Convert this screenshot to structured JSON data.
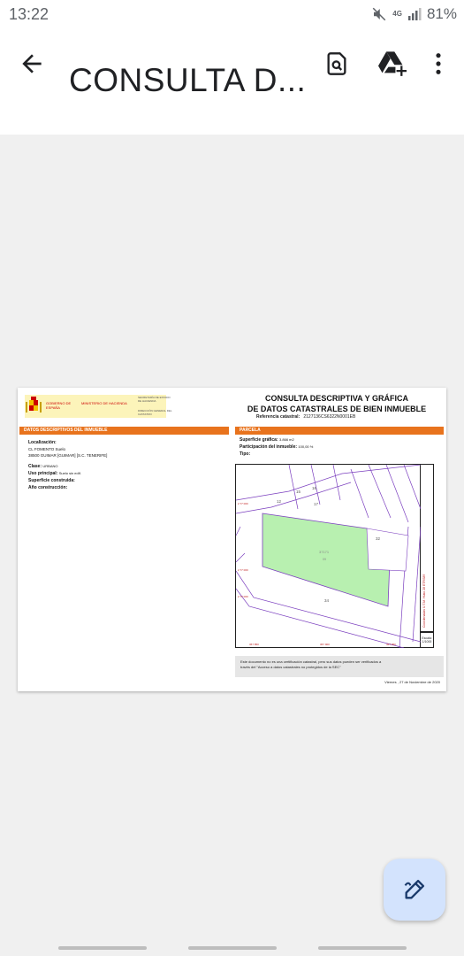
{
  "status_bar": {
    "time": "13:22",
    "network": "4G",
    "battery": "81%",
    "icons": [
      "mute-icon",
      "signal-icon",
      "battery-icon"
    ]
  },
  "app_bar": {
    "title": "CONSULTA D...",
    "icons": [
      "back-arrow-icon",
      "search-document-icon",
      "add-to-drive-icon",
      "more-vert-icon"
    ]
  },
  "document": {
    "ministry": "GOBIERNO DE ESPAÑA",
    "ministry2": "MINISTERIO DE HACIENDA",
    "secretaria": "SECRETARÍA DE ESTADO DE HACIENDA",
    "direccion": "DIRECCIÓN GENERAL DEL CATASTRO",
    "title_line1": "CONSULTA DESCRIPTIVA Y GRÁFICA",
    "title_line2": "DE DATOS CATASTRALES DE BIEN INMUEBLE",
    "ref_label": "Referencia catastral:",
    "ref_value": "2127136CS6322N0001EB",
    "left_section": "DATOS DESCRIPTIVOS DEL INMUEBLE",
    "right_section": "PARCELA",
    "localizacion_label": "Localización:",
    "address1": "CL FOMENTO  Suelo",
    "address2": "38500 GUIMAR [GUIMAR] [S.C. TENERIFE]",
    "clase_label": "Clase:",
    "clase_value": "URBANO",
    "uso_label": "Uso principal:",
    "uso_value": "Suelo sin edif.",
    "superficie_construida_label": "Superficie construida:",
    "anio_label": "Año construcción:",
    "superficie_grafica_label": "Superficie gráfica:",
    "superficie_grafica_value": "3.866 m2",
    "participacion_label": "Participación del inmueble:",
    "participacion_value": "100,00 %",
    "tipo_label": "Tipo:",
    "escala_label": "Escala:",
    "escala_value": "1/1000",
    "side_text": "Coordenadas U.T.M. Huso 28 ETRS89",
    "disclaimer_1": "Este documento no es una certificación catastral, pero sus datos pueden ser verificados a",
    "disclaimer_2": "través del \"Acceso a datos catastrales no protegidos de la SEC\"",
    "date": "Viernes , 27 de Noviembre de 2020",
    "map_labels": [
      "15",
      "16",
      "17",
      "12",
      "32",
      "34",
      "37171",
      "09"
    ]
  },
  "fab": {
    "icon": "edit-pen-icon"
  },
  "colors": {
    "accent_orange": "#e8731d",
    "parcel_green": "#b8f0b0",
    "plot_line": "#7b3fbf",
    "fab_bg": "#d3e3fd"
  }
}
